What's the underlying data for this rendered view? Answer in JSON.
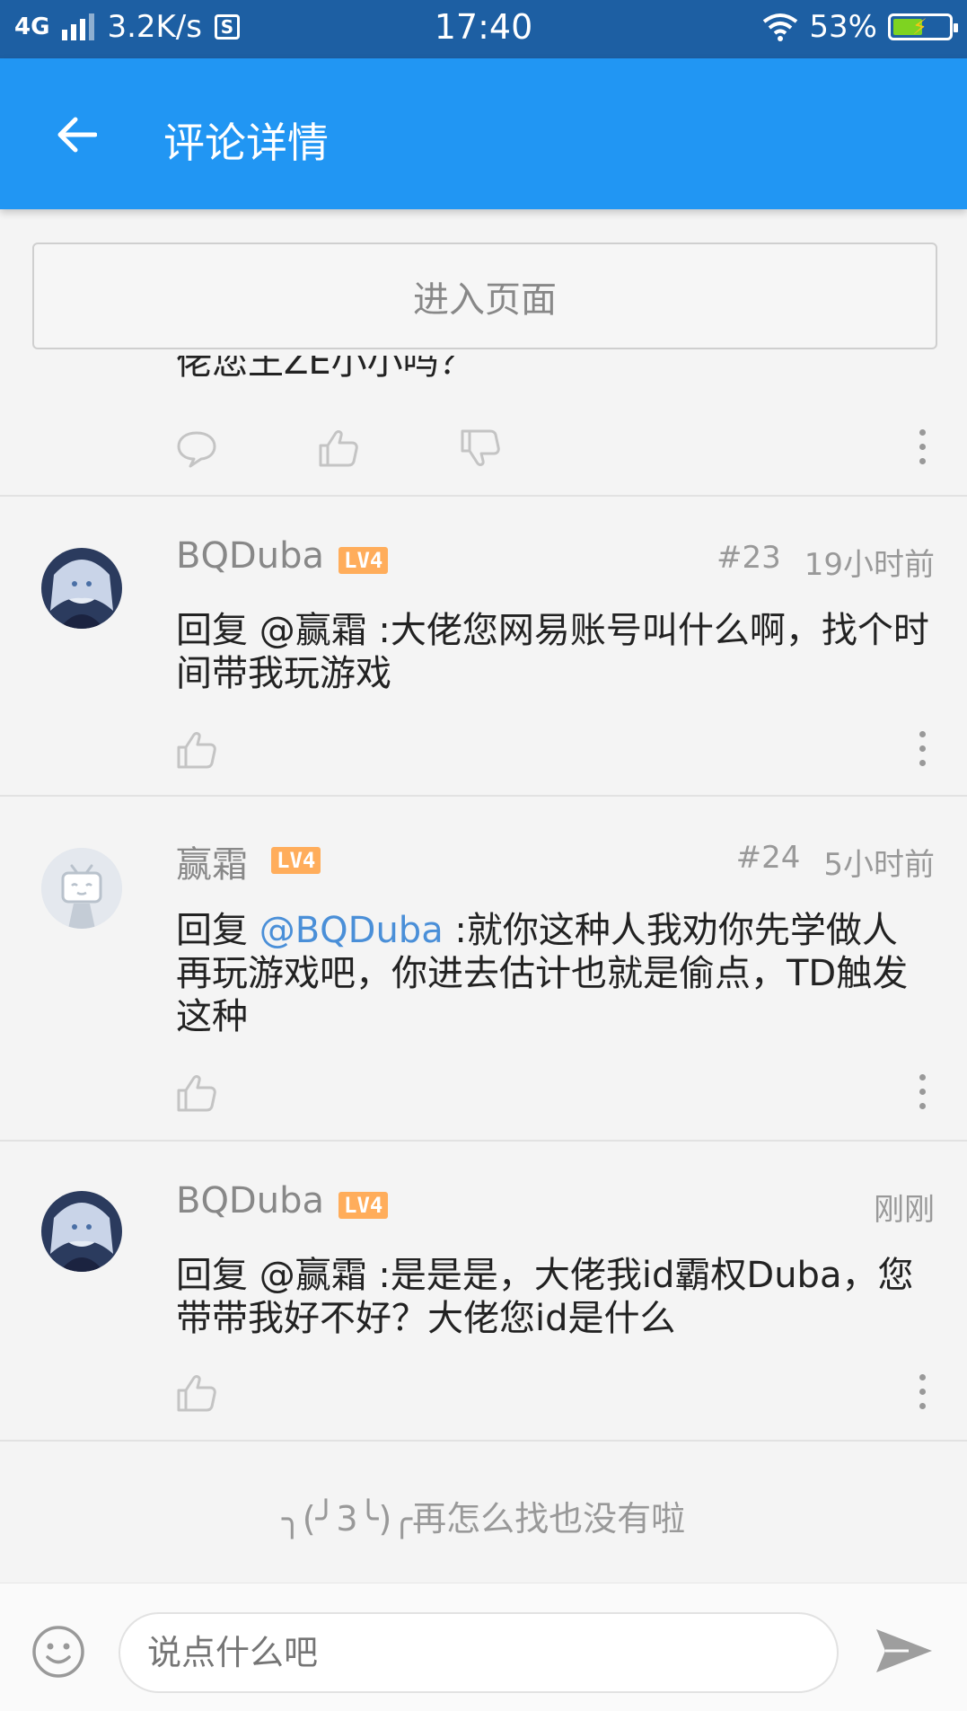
{
  "status_bar": {
    "network": "4G",
    "speed": "3.2K/s",
    "s_icon": "S",
    "time": "17:40",
    "battery": "53%",
    "battery_level": 0.53
  },
  "appbar": {
    "title": "评论详情"
  },
  "enter_page_label": "进入页面",
  "partial_comment": {
    "text": "佬您王ZE小小吗？"
  },
  "comments": [
    {
      "username": "BQDuba",
      "level": "LV4",
      "floor": "#23",
      "time": "19小时前",
      "prefix": "回复 @赢霜 :",
      "text": "大佬您网易账号叫什么啊，找个时间带我玩游戏"
    },
    {
      "username": "赢霜",
      "level": "LV4",
      "floor": "#24",
      "time": "5小时前",
      "prefix": "回复 ",
      "mention": "@BQDuba",
      "text": " :就你这种人我劝你先学做人再玩游戏吧，你进去估计也就是偷点，TD触发这种"
    },
    {
      "username": "BQDuba",
      "level": "LV4",
      "floor": "",
      "time": "刚刚",
      "prefix": "回复 @赢霜 :",
      "text": "是是是，大佬我id霸权Duba，您带带我好不好？大佬您id是什么"
    }
  ],
  "end_text": "╮(╯3╰)╭再怎么找也没有啦",
  "input": {
    "placeholder": "说点什么吧"
  },
  "colors": {
    "status_bar": "#1d5fa3",
    "app_bar": "#2196f3",
    "mention": "#4a8fd8",
    "level_badge": "#ffad5b"
  }
}
